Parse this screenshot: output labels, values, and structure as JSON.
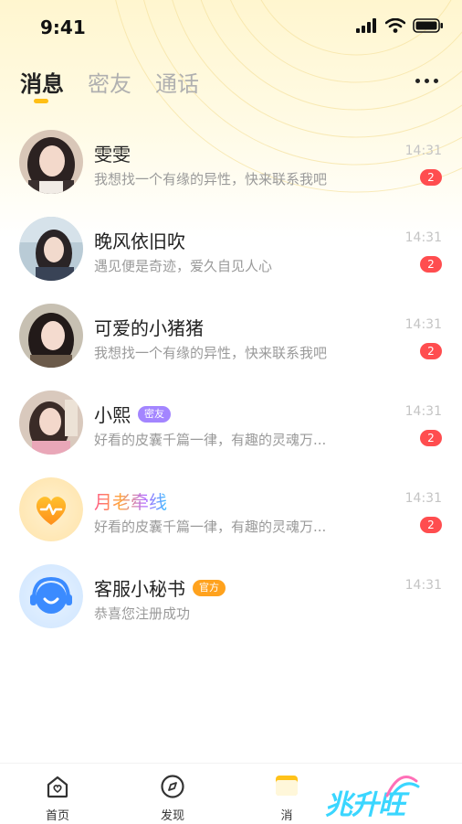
{
  "status": {
    "time": "9:41"
  },
  "tabs": [
    {
      "label": "消息",
      "active": true
    },
    {
      "label": "密友",
      "active": false
    },
    {
      "label": "通话",
      "active": false
    }
  ],
  "conversations": [
    {
      "name": "雯雯",
      "preview": "我想找一个有缘的异性，快来联系我吧",
      "time": "14:31",
      "unread": "2",
      "tag": ""
    },
    {
      "name": "晚风依旧吹",
      "preview": "遇见便是奇迹，爱久自见人心",
      "time": "14:31",
      "unread": "2",
      "tag": ""
    },
    {
      "name": "可爱的小猪猪",
      "preview": "我想找一个有缘的异性，快来联系我吧",
      "time": "14:31",
      "unread": "2",
      "tag": ""
    },
    {
      "name": "小熙",
      "preview": "好看的皮囊千篇一律，有趣的灵魂万...",
      "time": "14:31",
      "unread": "2",
      "tag": "密友"
    },
    {
      "name": "月老牵线",
      "preview": "好看的皮囊千篇一律，有趣的灵魂万...",
      "time": "14:31",
      "unread": "2",
      "tag": ""
    },
    {
      "name": "客服小秘书",
      "preview": "恭喜您注册成功",
      "time": "14:31",
      "unread": "",
      "tag": "官方"
    }
  ],
  "tabbar": [
    {
      "label": "首页",
      "icon": "home-icon"
    },
    {
      "label": "发现",
      "icon": "compass-icon"
    },
    {
      "label": "消",
      "icon": "message-icon"
    }
  ],
  "watermark": "兆升旺",
  "colors": {
    "accent": "#ffbf16",
    "badge": "#ff4d4f",
    "tag_purple": "#a385ff",
    "tag_orange": "#ffa21d"
  }
}
